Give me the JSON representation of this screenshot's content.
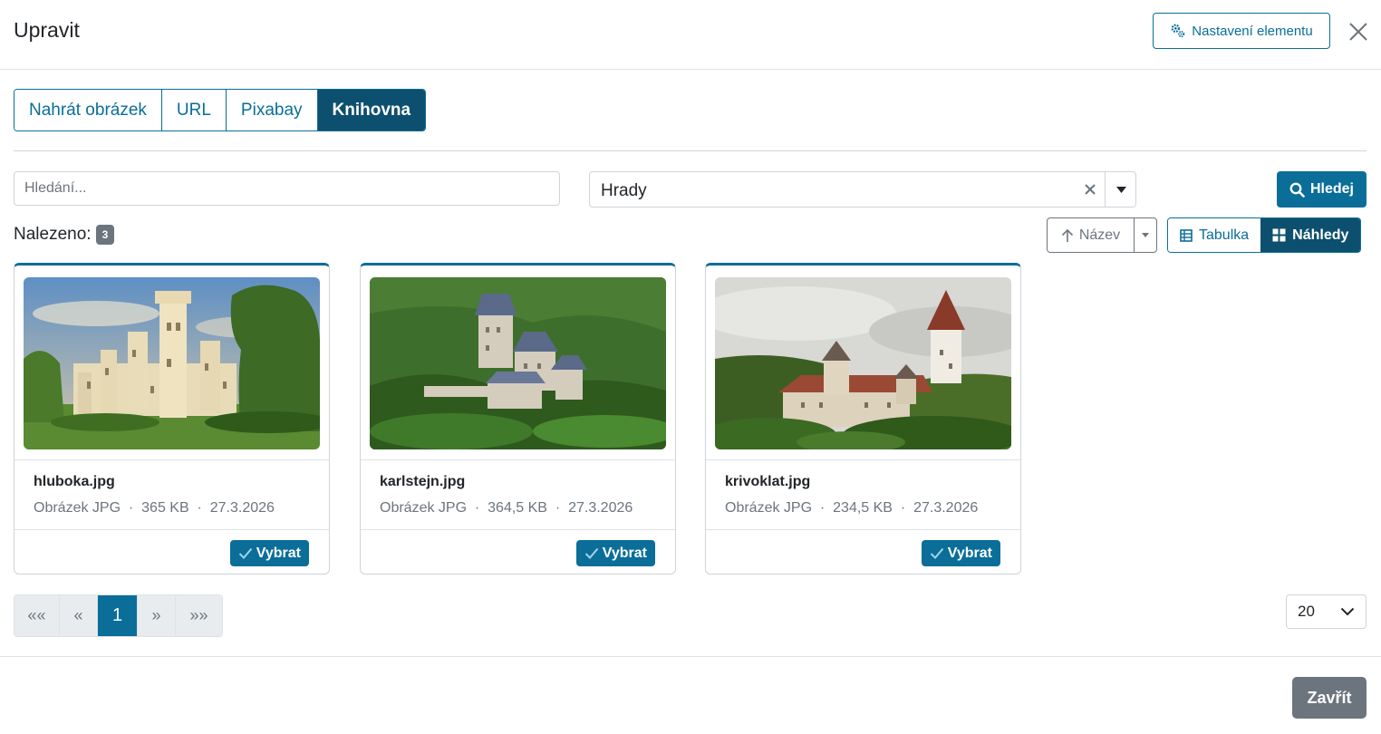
{
  "header": {
    "title": "Upravit",
    "settings_label": "Nastavení elementu"
  },
  "tabs": [
    {
      "label": "Nahrát obrázek",
      "active": false
    },
    {
      "label": "URL",
      "active": false
    },
    {
      "label": "Pixabay",
      "active": false
    },
    {
      "label": "Knihovna",
      "active": true
    }
  ],
  "search": {
    "placeholder": "Hledání...",
    "value": "",
    "category_value": "Hrady",
    "search_label": "Hledej"
  },
  "results": {
    "found_label": "Nalezeno:",
    "count": "3",
    "sort_label": "Název",
    "view_table_label": "Tabulka",
    "view_previews_label": "Náhledy"
  },
  "cards": [
    {
      "name": "hluboka.jpg",
      "type": "Obrázek JPG",
      "size": "365 KB",
      "date": "27.3.2026",
      "select_label": "Vybrat"
    },
    {
      "name": "karlstejn.jpg",
      "type": "Obrázek JPG",
      "size": "364,5 KB",
      "date": "27.3.2026",
      "select_label": "Vybrat"
    },
    {
      "name": "krivoklat.jpg",
      "type": "Obrázek JPG",
      "size": "234,5 KB",
      "date": "27.3.2026",
      "select_label": "Vybrat"
    }
  ],
  "meta_separator": "·",
  "pagination": {
    "first": "««",
    "prev": "«",
    "current": "1",
    "next": "»",
    "last": "»»",
    "per_page": "20"
  },
  "footer": {
    "close_label": "Zavřít"
  },
  "colors": {
    "primary": "#0a6e99",
    "primary_dark": "#0d4f6e",
    "secondary": "#6c757d"
  }
}
